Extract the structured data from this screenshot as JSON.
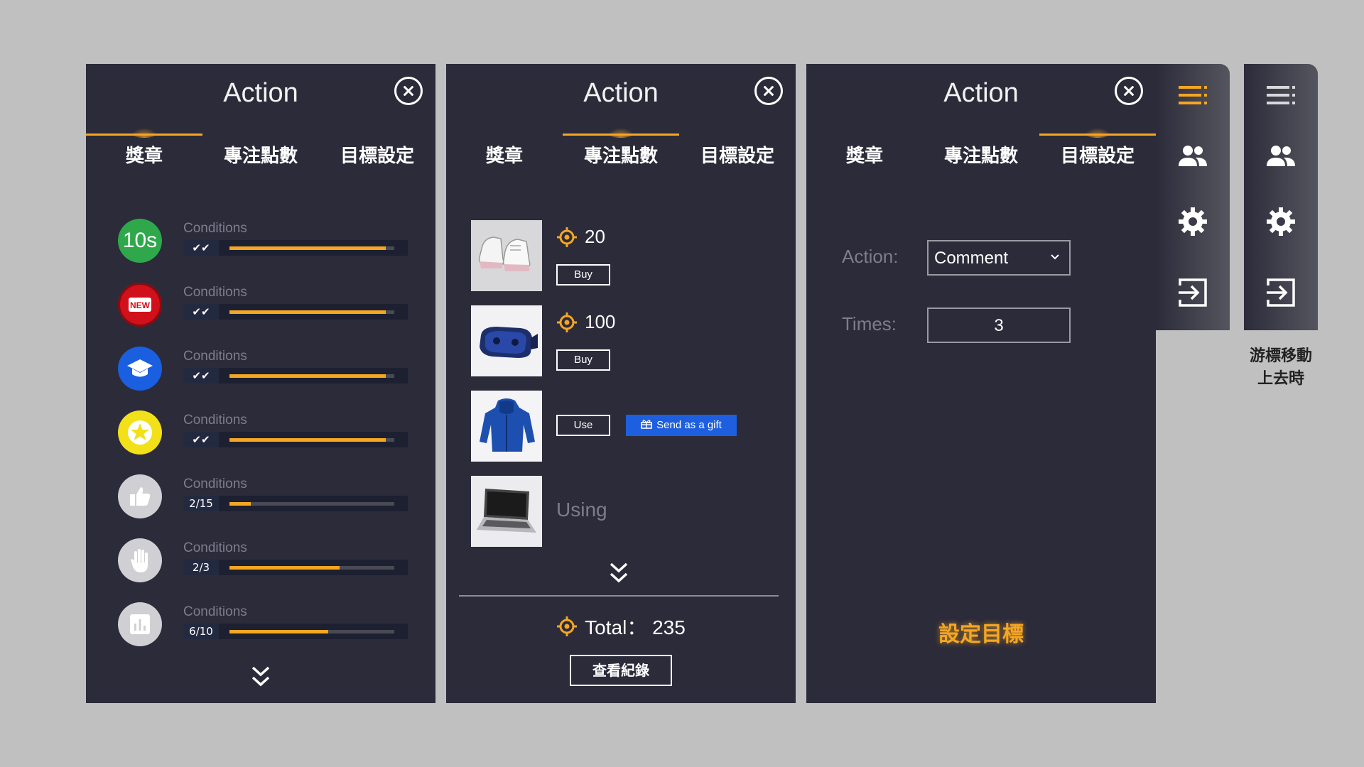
{
  "achievements_panel": {
    "title": "Action",
    "tabs": [
      "獎章",
      "專注點數",
      "目標設定"
    ],
    "active_tab": 0,
    "items": [
      {
        "icon": "10s-icon",
        "label": "Conditions",
        "badge": "✔✔",
        "progress": 0.95,
        "color": "#2ea84a"
      },
      {
        "icon": "new-badge-icon",
        "label": "Conditions",
        "badge": "✔✔",
        "progress": 0.95,
        "color": "#d0101a"
      },
      {
        "icon": "graduation-cap-icon",
        "label": "Conditions",
        "badge": "✔✔",
        "progress": 0.95,
        "color": "#1a5fe0"
      },
      {
        "icon": "star-icon",
        "label": "Conditions",
        "badge": "✔✔",
        "progress": 0.95,
        "color": "#f2e019"
      },
      {
        "icon": "thumbs-up-icon",
        "label": "Conditions",
        "badge": "2/15",
        "progress": 0.13,
        "color": "#d0d0d4"
      },
      {
        "icon": "hand-icon",
        "label": "Conditions",
        "badge": "2/3",
        "progress": 0.67,
        "color": "#d0d0d4"
      },
      {
        "icon": "chart-icon",
        "label": "Conditions",
        "badge": "6/10",
        "progress": 0.6,
        "color": "#d0d0d4"
      }
    ]
  },
  "shop_panel": {
    "title": "Action",
    "tabs": [
      "獎章",
      "專注點數",
      "目標設定"
    ],
    "active_tab": 1,
    "items": [
      {
        "image": "sneakers-image",
        "price": "20",
        "button": "Buy"
      },
      {
        "image": "vr-headset-image",
        "price": "100",
        "button": "Buy"
      },
      {
        "image": "hoodie-image",
        "button": "Use",
        "gift_button": "Send as a gift"
      },
      {
        "image": "laptop-image",
        "status": "Using"
      }
    ],
    "total_label": "Total： 235",
    "record_button": "查看紀錄"
  },
  "goal_panel": {
    "title": "Action",
    "tabs": [
      "獎章",
      "專注點數",
      "目標設定"
    ],
    "active_tab": 2,
    "action_label": "Action:",
    "action_value": "Comment",
    "times_label": "Times:",
    "times_value": "3",
    "set_goal_link": "設定目標"
  },
  "sidebar": {
    "icons": [
      "menu-icon",
      "users-icon",
      "settings-icon",
      "logout-icon"
    ],
    "active_color": "#f5a623",
    "hover_note": "游標移動上去時"
  },
  "colors": {
    "panel_bg": "#2c2b3a",
    "accent": "#f5a623",
    "page_bg": "#c0c0c0",
    "gift_button": "#1e5fe0"
  }
}
